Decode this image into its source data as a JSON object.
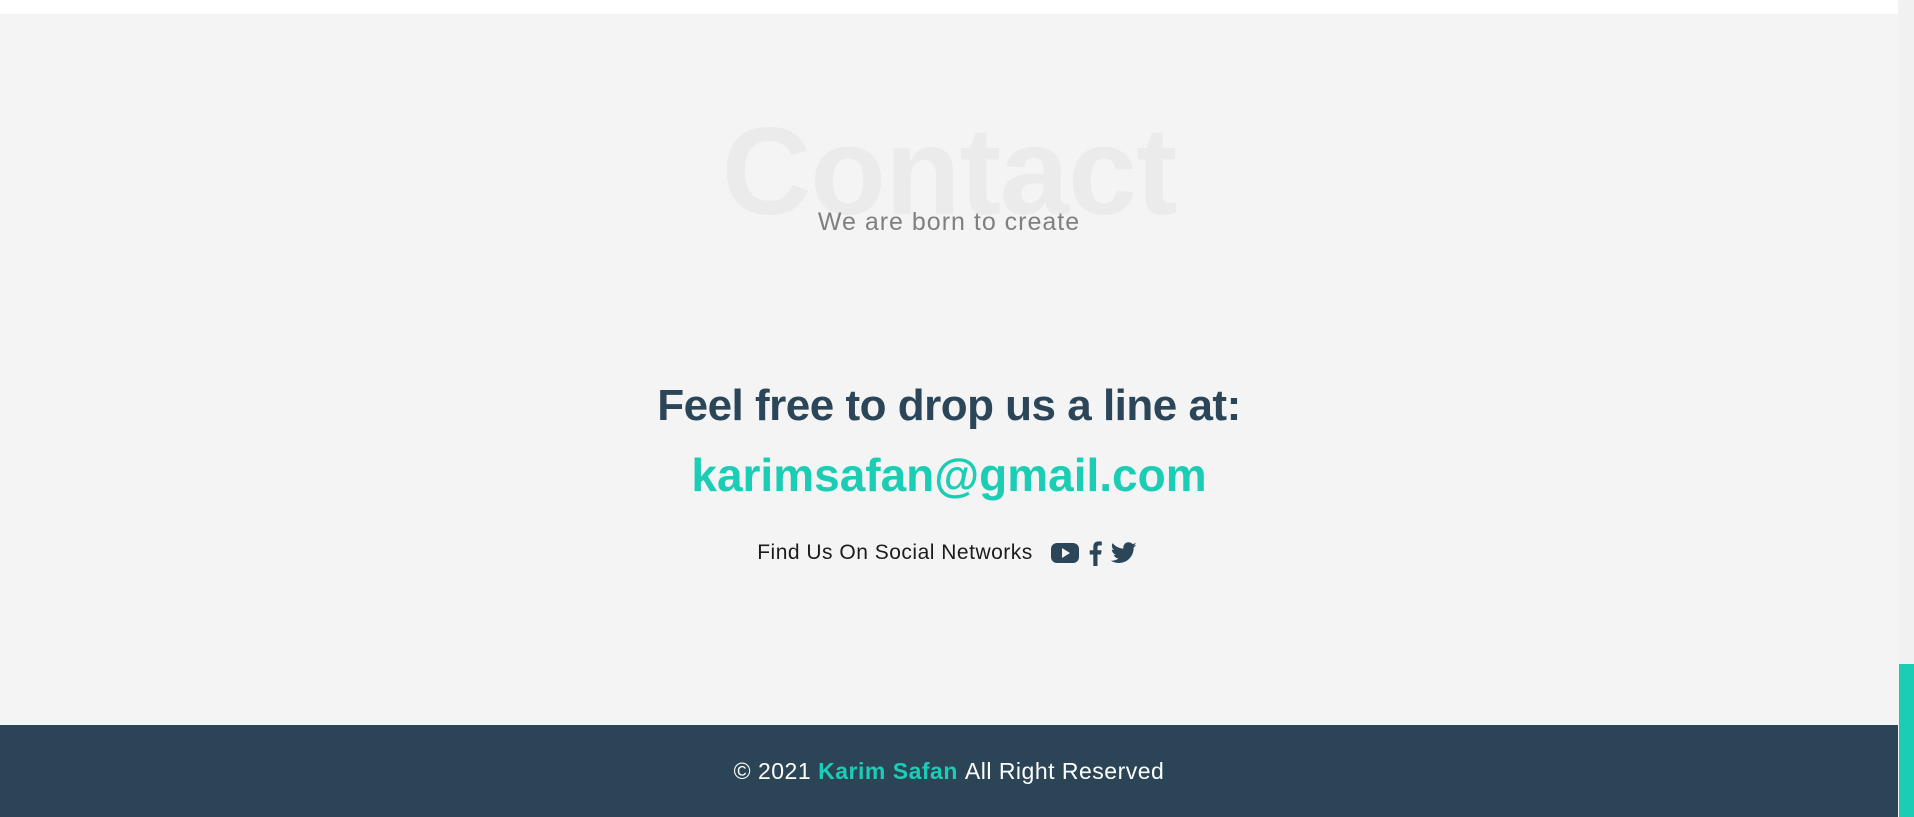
{
  "contact": {
    "watermark": "Contact",
    "subtitle": "We are born to create",
    "heading": "Feel free to drop us a line at:",
    "email": "karimsafan@gmail.com"
  },
  "social": {
    "label": "Find Us On Social Networks",
    "icons": [
      "youtube-icon",
      "facebook-icon",
      "twitter-icon"
    ]
  },
  "footer": {
    "copyright": "© 2021",
    "name": "Karim Safan",
    "rights": "All Right Reserved"
  },
  "colors": {
    "accent": "#1ccdb5",
    "heading": "#2c4659",
    "footer_bg": "#2b4557",
    "section_bg": "#f4f4f4"
  }
}
